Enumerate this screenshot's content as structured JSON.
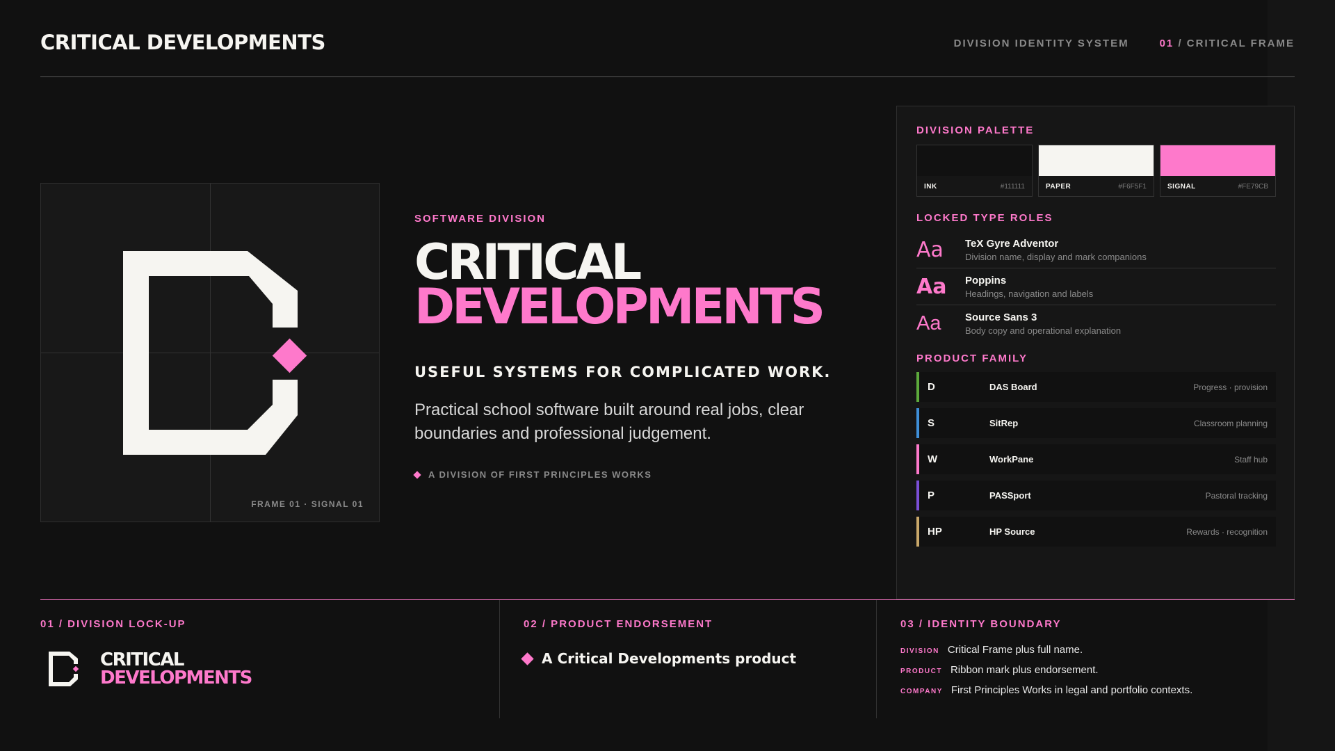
{
  "header": {
    "title": "CRITICAL DEVELOPMENTS",
    "system_label": "DIVISION IDENTITY SYSTEM",
    "frame_number": "01",
    "frame_label": "/ CRITICAL FRAME"
  },
  "mark_panel": {
    "caption": "FRAME 01 · SIGNAL 01"
  },
  "hero": {
    "eyebrow": "SOFTWARE DIVISION",
    "name_line1": "CRITICAL",
    "name_line2": "DEVELOPMENTS",
    "tagline": "USEFUL SYSTEMS FOR COMPLICATED WORK.",
    "description": "Practical school software built around real jobs, clear boundaries and professional judgement.",
    "division_of": "A DIVISION OF FIRST PRINCIPLES WORKS"
  },
  "palette": {
    "heading": "DIVISION PALETTE",
    "swatches": [
      {
        "name": "INK",
        "hex": "#111111",
        "color": "#111111"
      },
      {
        "name": "PAPER",
        "hex": "#F6F5F1",
        "color": "#F6F5F1"
      },
      {
        "name": "SIGNAL",
        "hex": "#FE79CB",
        "color": "#FE79CB"
      }
    ]
  },
  "type_roles": {
    "heading": "LOCKED TYPE ROLES",
    "items": [
      {
        "sample": "Aa",
        "name": "TeX Gyre Adventor",
        "desc": "Division name, display and mark companions"
      },
      {
        "sample": "Aa",
        "name": "Poppins",
        "desc": "Headings, navigation and labels"
      },
      {
        "sample": "Aa",
        "name": "Source Sans 3",
        "desc": "Body copy and operational explanation"
      }
    ]
  },
  "products": {
    "heading": "PRODUCT FAMILY",
    "items": [
      {
        "letter": "D",
        "name": "DAS Board",
        "desc": "Progress · provision",
        "accent": "#5DAA3C"
      },
      {
        "letter": "S",
        "name": "SitRep",
        "desc": "Classroom planning",
        "accent": "#3F8FD8"
      },
      {
        "letter": "W",
        "name": "WorkPane",
        "desc": "Staff hub",
        "accent": "#FE79CB"
      },
      {
        "letter": "P",
        "name": "PASSport",
        "desc": "Pastoral tracking",
        "accent": "#7B4FD6"
      },
      {
        "letter": "HP",
        "name": "HP Source",
        "desc": "Rewards · recognition",
        "accent": "#C9A86A"
      }
    ]
  },
  "bottom": {
    "lockup_heading": "01 / DIVISION LOCK-UP",
    "lockup_line1": "CRITICAL",
    "lockup_line2": "DEVELOPMENTS",
    "endorse_heading": "02 / PRODUCT ENDORSEMENT",
    "endorse_text": "A Critical Developments product",
    "boundary_heading": "03 / IDENTITY BOUNDARY",
    "boundary_items": [
      {
        "label": "DIVISION",
        "text": "Critical Frame plus full name."
      },
      {
        "label": "PRODUCT",
        "text": "Ribbon mark plus endorsement."
      },
      {
        "label": "COMPANY",
        "text": "First Principles Works in legal and portfolio contexts."
      }
    ]
  },
  "colors": {
    "ink": "#111111",
    "paper": "#F6F5F1",
    "signal": "#FE79CB"
  },
  "icons": [
    "d-frame-mark-icon",
    "diamond-icon"
  ]
}
